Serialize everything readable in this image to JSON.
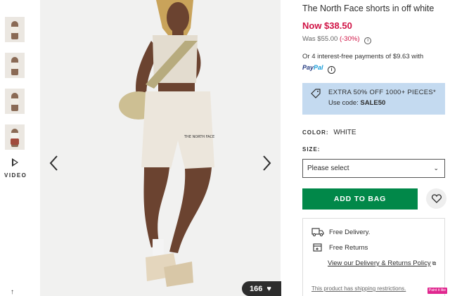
{
  "gallery": {
    "thumbnails": [
      "thumbnail-1",
      "thumbnail-2",
      "thumbnail-3",
      "thumbnail-4"
    ],
    "video_label": "VIDEO",
    "scroll_up_icon": "↑",
    "like_count": "166",
    "prev_icon": "chevron-left-icon",
    "next_icon": "chevron-right-icon"
  },
  "product": {
    "title": "The North Face shorts in off white",
    "price_now": "Now $38.50",
    "price_was": "Was $55.00",
    "discount": "(-30%)",
    "installments": "Or 4 interest-free payments of $9.63 with",
    "paypal_pay": "Pay",
    "paypal_pal": "Pal",
    "info_glyph": "i",
    "hero_logo": "THE NORTH FACE"
  },
  "promo": {
    "line1": "EXTRA 50% OFF 1000+ PIECES*",
    "code_prefix": "Use code: ",
    "code": "SALE50",
    "bg_color": "#c4daf0"
  },
  "options": {
    "colour_label": "COLOR:",
    "colour_value": "WHITE",
    "size_label": "SIZE:",
    "size_placeholder": "Please select",
    "chevron": "⌄"
  },
  "actions": {
    "add_to_bag": "ADD TO BAG",
    "accent_color": "#018849",
    "sale_color": "#d01345"
  },
  "delivery": {
    "free_delivery": "Free Delivery.",
    "free_returns": "Free Returns",
    "policy_link": "View our Delivery & Returns Policy",
    "shipping_restrictions": "This product has shipping restrictions."
  },
  "overlay": {
    "badge": "Paint it like"
  }
}
